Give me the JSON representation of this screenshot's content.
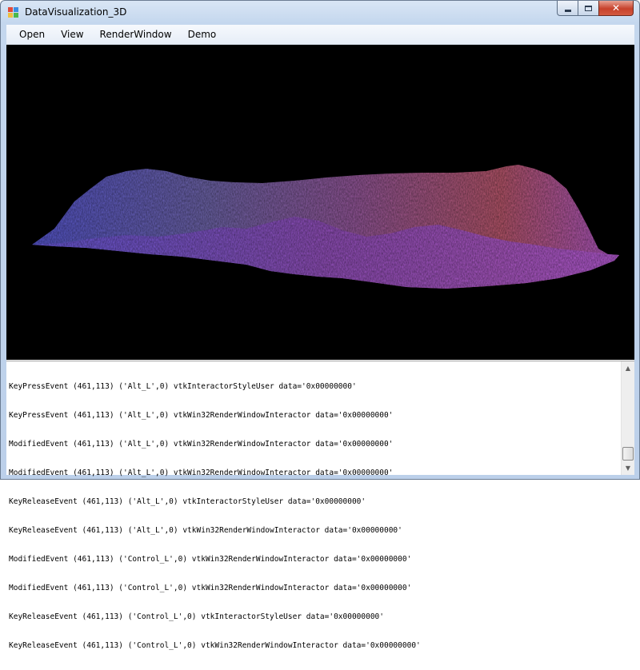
{
  "window": {
    "title": "DataVisualization_3D",
    "icon": "app-window-icon",
    "caption_buttons": [
      "minimize-icon",
      "maximize-icon",
      "close-icon"
    ],
    "close_glyph": "✕"
  },
  "menu": {
    "items": [
      {
        "label": "Open"
      },
      {
        "label": "View"
      },
      {
        "label": "RenderWindow"
      },
      {
        "label": "Demo"
      }
    ]
  },
  "render_view": {
    "background": "#000000",
    "surface_colors": [
      "#5a5ae0",
      "#7a6ab8",
      "#a35a9a",
      "#c65a6a",
      "#b060d8"
    ]
  },
  "log": {
    "lines": [
      "KeyPressEvent (461,113) ('Alt_L',0) vtkInteractorStyleUser data='0x00000000'",
      "KeyPressEvent (461,113) ('Alt_L',0) vtkWin32RenderWindowInteractor data='0x00000000'",
      "ModifiedEvent (461,113) ('Alt_L',0) vtkWin32RenderWindowInteractor data='0x00000000'",
      "ModifiedEvent (461,113) ('Alt_L',0) vtkWin32RenderWindowInteractor data='0x00000000'",
      "KeyReleaseEvent (461,113) ('Alt_L',0) vtkInteractorStyleUser data='0x00000000'",
      "KeyReleaseEvent (461,113) ('Alt_L',0) vtkWin32RenderWindowInteractor data='0x00000000'",
      "ModifiedEvent (461,113) ('Control_L',0) vtkWin32RenderWindowInteractor data='0x00000000'",
      "ModifiedEvent (461,113) ('Control_L',0) vtkWin32RenderWindowInteractor data='0x00000000'",
      "KeyReleaseEvent (461,113) ('Control_L',0) vtkInteractorStyleUser data='0x00000000'",
      "KeyReleaseEvent (461,113) ('Control_L',0) vtkWin32RenderWindowInteractor data='0x00000000'"
    ],
    "scroll_up_glyph": "▲",
    "scroll_down_glyph": "▼"
  }
}
